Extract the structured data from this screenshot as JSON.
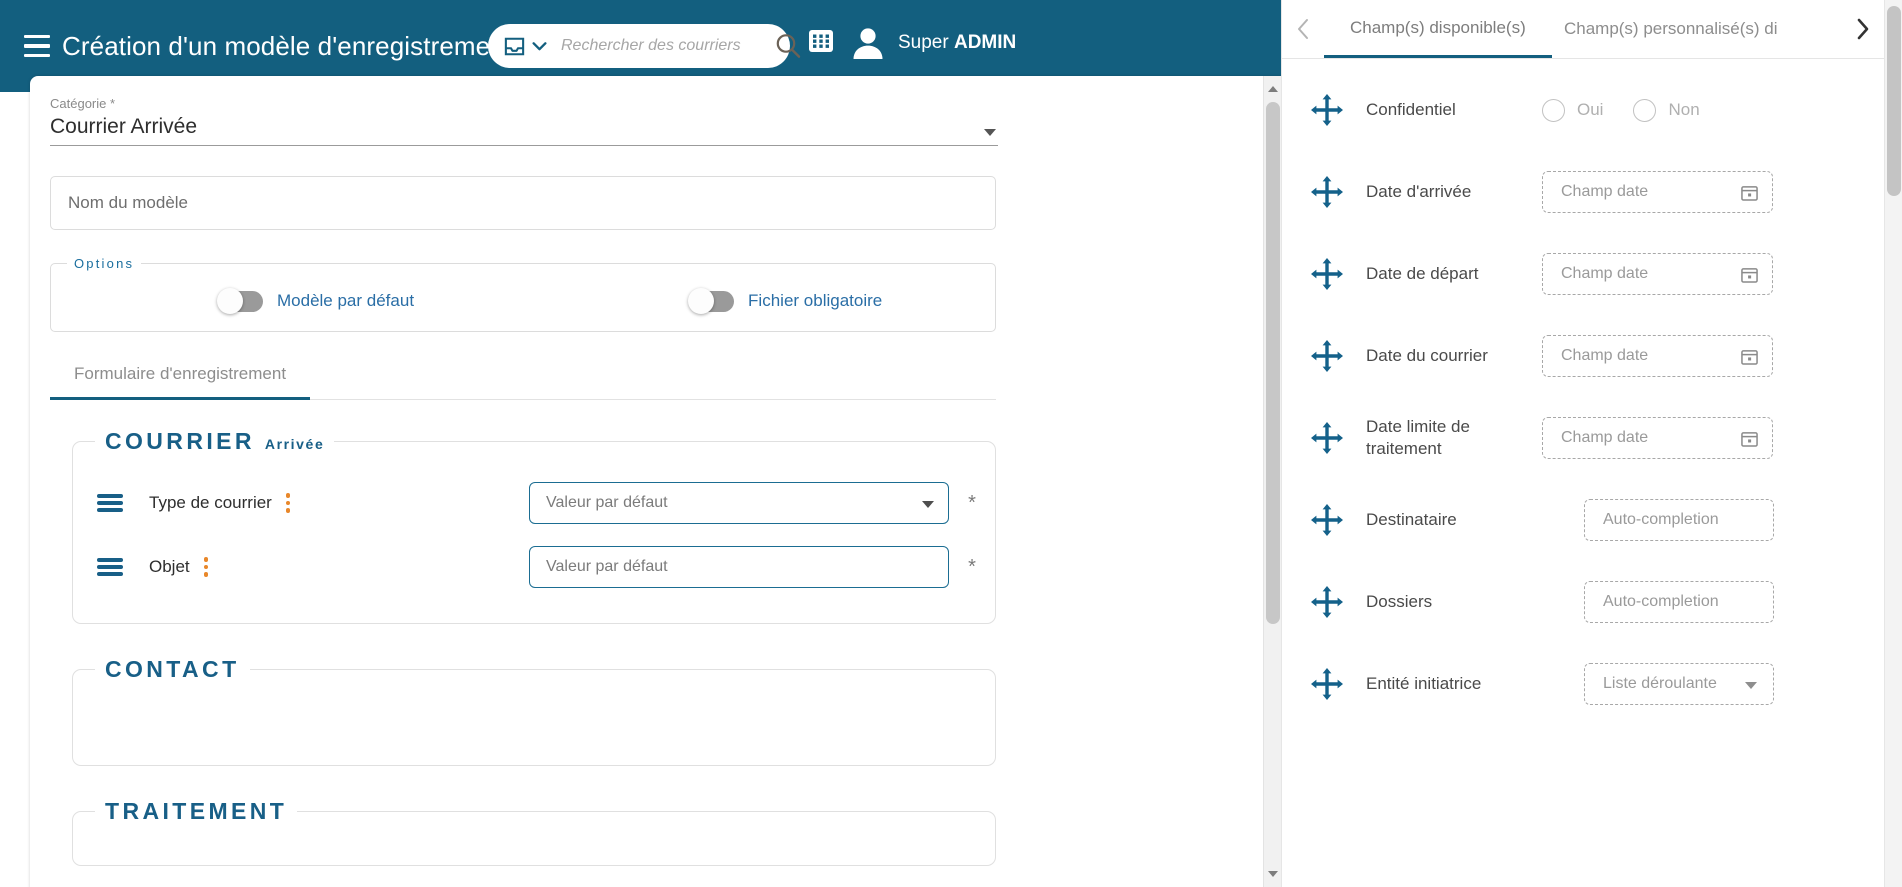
{
  "header": {
    "title": "Création d'un modèle d'enregistrement",
    "menu_icon": "hamburger-icon",
    "search": {
      "scope_icon": "inbox-icon",
      "scope_chevron_icon": "chevron-down-icon",
      "placeholder": "Rechercher des courriers",
      "value": "",
      "submit_icon": "search-icon"
    },
    "apps_icon": "grid-apps-icon",
    "avatar_icon": "user-avatar-icon",
    "user_first": "Super ",
    "user_last": "ADMIN",
    "bg_color": "#135F7F"
  },
  "form": {
    "category_label": "Catégorie *",
    "category_value": "Courrier Arrivée",
    "category_arrow_icon": "chevron-down-icon",
    "model_name_placeholder": "Nom du modèle",
    "model_name_value": "",
    "options_legend": "Options",
    "options": [
      {
        "label": "Modèle par défaut",
        "state": "off"
      },
      {
        "label": "Fichier obligatoire",
        "state": "off"
      }
    ],
    "tabs": [
      {
        "label": "Formulaire d'enregistrement",
        "active": true
      }
    ],
    "sections": [
      {
        "title": "COURRIER",
        "subtitle": "Arrivée",
        "rows": [
          {
            "drag_icon": "drag-handle-icon",
            "label": "Type de courrier",
            "menu_icon": "kebab-menu-icon",
            "value_placeholder": "Valeur par défaut",
            "value": "",
            "control": "dropdown",
            "required_mark": "*"
          },
          {
            "drag_icon": "drag-handle-icon",
            "label": "Objet",
            "menu_icon": "kebab-menu-icon",
            "value_placeholder": "Valeur par défaut",
            "value": "",
            "control": "text",
            "required_mark": "*"
          }
        ]
      },
      {
        "title": "CONTACT",
        "subtitle": "",
        "rows": []
      },
      {
        "title": "TRAITEMENT",
        "subtitle": "",
        "rows": []
      }
    ],
    "scrollbar": {
      "up_icon": "scroll-up-arrow-icon",
      "down_icon": "scroll-down-arrow-icon"
    }
  },
  "side_panel": {
    "prev_icon": "chevron-left-icon",
    "next_icon": "chevron-right-icon",
    "tabs": [
      {
        "label": "Champ(s) disponible(s)",
        "active": true
      },
      {
        "label": "Champ(s) personnalisé(s) di",
        "active": false
      }
    ],
    "fields": [
      {
        "drag_icon": "move-arrows-icon",
        "label": "Confidentiel",
        "control": "radio",
        "options": [
          "Oui",
          "Non"
        ]
      },
      {
        "drag_icon": "move-arrows-icon",
        "label": "Date d'arrivée",
        "control": "date",
        "placeholder": "Champ date",
        "trailing_icon": "calendar-icon"
      },
      {
        "drag_icon": "move-arrows-icon",
        "label": "Date de départ",
        "control": "date",
        "placeholder": "Champ date",
        "trailing_icon": "calendar-icon"
      },
      {
        "drag_icon": "move-arrows-icon",
        "label": "Date du courrier",
        "control": "date",
        "placeholder": "Champ date",
        "trailing_icon": "calendar-icon"
      },
      {
        "drag_icon": "move-arrows-icon",
        "label": "Date limite de traitement",
        "control": "date",
        "placeholder": "Champ date",
        "trailing_icon": "calendar-icon"
      },
      {
        "drag_icon": "move-arrows-icon",
        "label": "Destinataire",
        "control": "autocomplete",
        "placeholder": "Auto-completion"
      },
      {
        "drag_icon": "move-arrows-icon",
        "label": "Dossiers",
        "control": "autocomplete",
        "placeholder": "Auto-completion"
      },
      {
        "drag_icon": "move-arrows-icon",
        "label": "Entité initiatrice",
        "control": "select",
        "placeholder": "Liste déroulante",
        "trailing_icon": "chevron-down-icon"
      }
    ]
  },
  "colors": {
    "brand": "#135F7F",
    "section_title": "#185F87",
    "accent_orange": "#E8872A",
    "field_border": "#1b6d92"
  }
}
